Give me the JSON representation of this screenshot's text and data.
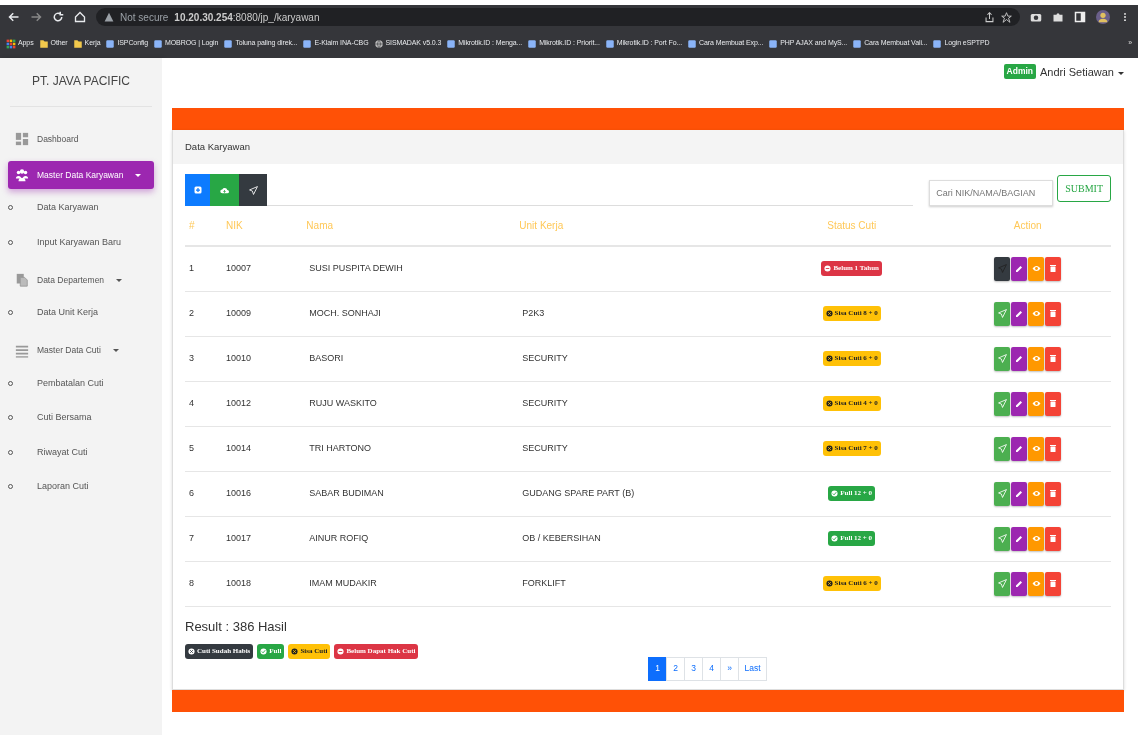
{
  "browser": {
    "security": "Not secure",
    "url": "**10.20.30.254**:8080/jp_/karyawan",
    "bookmarks": [
      {
        "kind": "apps",
        "label": "Apps"
      },
      {
        "kind": "folder",
        "label": "Other"
      },
      {
        "kind": "folder",
        "label": "Kerja"
      },
      {
        "kind": "site",
        "label": "ISPConfig"
      },
      {
        "kind": "site",
        "label": "MOBROG | Login"
      },
      {
        "kind": "site",
        "label": "Toluna paling direk..."
      },
      {
        "kind": "site",
        "label": "E-Klaim INA-CBG"
      },
      {
        "kind": "globe",
        "label": "SISMADAK v5.0.3"
      },
      {
        "kind": "site",
        "label": "Mikrotik.ID : Menga..."
      },
      {
        "kind": "site",
        "label": "Mikrotik.ID : Priorit..."
      },
      {
        "kind": "site",
        "label": "Mikrotik.ID : Port Fo..."
      },
      {
        "kind": "site",
        "label": "Cara Membuat Exp..."
      },
      {
        "kind": "site",
        "label": "PHP AJAX and MyS..."
      },
      {
        "kind": "site",
        "label": "Cara Membuat Vali..."
      },
      {
        "kind": "site",
        "label": "Login eSPTPD"
      }
    ],
    "more": "»"
  },
  "sidebar": {
    "brand": "PT. JAVA PACIFIC",
    "items": [
      {
        "kind": "dashboard",
        "label": "Dashboard",
        "dropdown": false,
        "selected": false
      },
      {
        "kind": "users",
        "label": "Master Data Karyawan",
        "dropdown": true,
        "selected": true
      },
      {
        "kind": "sub",
        "label": "Data Karyawan"
      },
      {
        "kind": "sub",
        "label": "Input Karyawan Baru"
      },
      {
        "kind": "files",
        "label": "Data Departemen",
        "dropdown": true,
        "selected": false
      },
      {
        "kind": "sub",
        "label": "Data Unit Kerja"
      },
      {
        "kind": "list",
        "label": "Master Data Cuti",
        "dropdown": true,
        "selected": false
      },
      {
        "kind": "sub",
        "label": "Pembatalan Cuti"
      },
      {
        "kind": "sub",
        "label": "Cuti Bersama"
      },
      {
        "kind": "sub",
        "label": "Riwayat Cuti"
      },
      {
        "kind": "sub",
        "label": "Laporan Cuti"
      }
    ]
  },
  "user": {
    "role": "Admin",
    "name": "Andri Setiawan"
  },
  "card": {
    "title": "Data Karyawan",
    "search": {
      "placeholder": "Cari NIK/NAMA/BAGIAN"
    },
    "submit": "SUBMIT",
    "columns": [
      "#",
      "NIK",
      "Nama",
      "Unit Kerja",
      "Status Cuti",
      "Action"
    ],
    "rows": [
      {
        "no": "1",
        "nik": "10007",
        "nama": "SUSI PUSPITA DEWIH",
        "unit": "",
        "status": {
          "kind": "belum",
          "text": "Belum 1 Tahun"
        },
        "send_disabled": true
      },
      {
        "no": "2",
        "nik": "10009",
        "nama": "MOCH. SONHAJI",
        "unit": "P2K3",
        "status": {
          "kind": "sisa",
          "text": "Sisa Cuti 8 + 0"
        },
        "send_disabled": false
      },
      {
        "no": "3",
        "nik": "10010",
        "nama": "BASORI",
        "unit": "SECURITY",
        "status": {
          "kind": "sisa",
          "text": "Sisa Cuti 6 + 0"
        },
        "send_disabled": false
      },
      {
        "no": "4",
        "nik": "10012",
        "nama": "RUJU WASKITO",
        "unit": "SECURITY",
        "status": {
          "kind": "sisa",
          "text": "Sisa Cuti 4 + 0"
        },
        "send_disabled": false
      },
      {
        "no": "5",
        "nik": "10014",
        "nama": "TRI HARTONO",
        "unit": "SECURITY",
        "status": {
          "kind": "sisa",
          "text": "Sisa Cuti 7 + 0"
        },
        "send_disabled": false
      },
      {
        "no": "6",
        "nik": "10016",
        "nama": "SABAR BUDIMAN",
        "unit": "GUDANG SPARE PART (B)",
        "status": {
          "kind": "full",
          "text": "Full 12 + 0"
        },
        "send_disabled": false
      },
      {
        "no": "7",
        "nik": "10017",
        "nama": "AINUR ROFIQ",
        "unit": "OB / KEBERSIHAN",
        "status": {
          "kind": "full",
          "text": "Full 12 + 0"
        },
        "send_disabled": false
      },
      {
        "no": "8",
        "nik": "10018",
        "nama": "IMAM MUDAKIR",
        "unit": "FORKLIFT",
        "status": {
          "kind": "sisa",
          "text": "Sisa Cuti 6 + 0"
        },
        "send_disabled": false
      }
    ],
    "result": "Result : 386 Hasil",
    "legend": [
      {
        "kind": "habis",
        "text": "Cuti Sudah Habis"
      },
      {
        "kind": "full",
        "text": "Full"
      },
      {
        "kind": "sisa",
        "text": "Sisa Cuti"
      },
      {
        "kind": "belum",
        "text": "Belum Dapat Hak Cuti"
      }
    ],
    "pages": [
      {
        "label": "1",
        "selected": true
      },
      {
        "label": "2",
        "selected": false
      },
      {
        "label": "3",
        "selected": false
      },
      {
        "label": "4",
        "selected": false
      },
      {
        "label": "»",
        "selected": false
      },
      {
        "label": "Last",
        "selected": false
      }
    ]
  }
}
